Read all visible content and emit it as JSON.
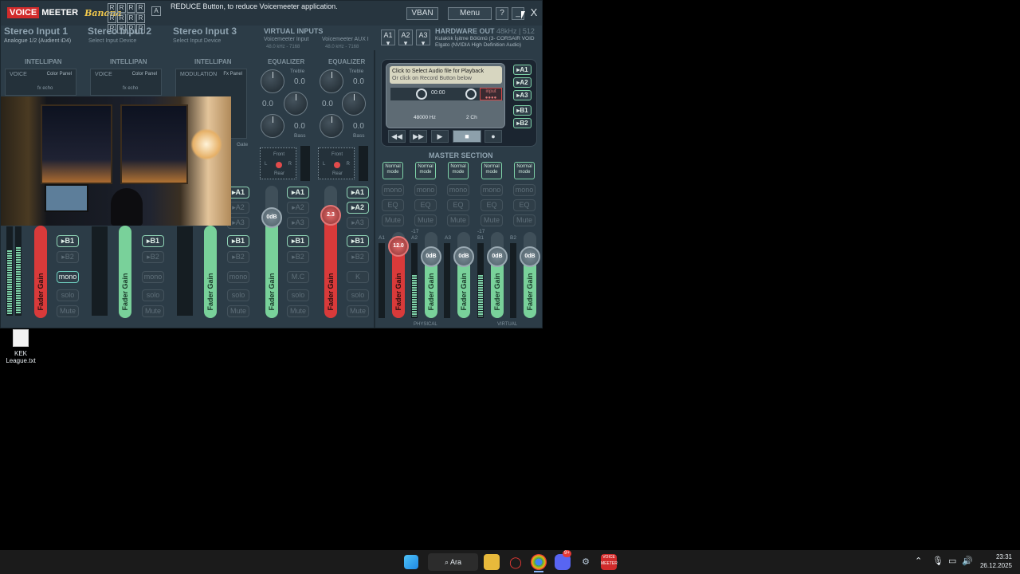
{
  "app": {
    "logo_voice": "VOICE",
    "logo_meeter": "MEETER",
    "logo_banana": "Banana",
    "r_letters": [
      "R",
      "R",
      "R",
      "R",
      "R",
      "R",
      "R",
      "R",
      "R",
      "R",
      "R",
      "R"
    ],
    "a_letter": "A",
    "tooltip": "REDUCE Button, to reduce Voicemeeter application.",
    "vban_label": "VBAN",
    "menu_label": "Menu",
    "help_label": "?",
    "minimize_label": "_",
    "close_label": "X"
  },
  "strips": [
    {
      "title": "Stereo Input 1",
      "device": "Analogue 1/2 (Audient iD4)",
      "intellipan": "INTELLIPAN",
      "panel_left": "VOICE",
      "panel_right": "Color Panel",
      "panel_sub": "fx echo"
    },
    {
      "title": "Stereo Input 2",
      "device": "Select Input Device",
      "intellipan": "INTELLIPAN",
      "panel_left": "VOICE",
      "panel_right": "Color Panel",
      "panel_sub": "fx echo"
    },
    {
      "title": "Stereo Input 3",
      "device": "Select Input Device",
      "intellipan": "INTELLIPAN",
      "panel_left": "MODULATION",
      "panel_right": "Fx Panel",
      "panel_sub": ""
    }
  ],
  "virtual_inputs": {
    "title": "VIRTUAL INPUTS",
    "vi1_name": "Voicemeeter Input",
    "vi1_rate": "48.0 kHz - 7168",
    "vi2_name": "Voicemeeter AUX I",
    "vi2_rate": "48.0 kHz - 7168",
    "eq_label": "EQUALIZER",
    "treble": "Treble",
    "bass": "Bass",
    "eq_vals": [
      "0.0",
      "0.0",
      "0.0",
      "0.0",
      "0.0",
      "0.0"
    ],
    "pan_front": "Front",
    "pan_rear": "Rear",
    "pan_l": "L",
    "pan_r": "R",
    "gate": "Gate"
  },
  "a_buttons": [
    "A1",
    "A2",
    "A3"
  ],
  "hardware_out": {
    "title": "HARDWARE OUT",
    "rate": "48kHz | 512",
    "dev1": "Kulaklık İşitme Bölümü (3- CORSAIR VOID",
    "dev2": "Elgato (NVIDIA High Definition Audio)"
  },
  "buses": {
    "a1": "A1",
    "a2": "A2",
    "a3": "A3",
    "b1": "B1",
    "b2": "B2",
    "mono": "mono",
    "solo": "solo",
    "mute": "Mute",
    "mc": "M.C",
    "k": "K",
    "fader_gain": "Fader Gain"
  },
  "faders": {
    "vi1_value": "0dB",
    "vi2_value": "2.3",
    "master_a1_value": "12.0",
    "master_other_value": "0dB"
  },
  "recorder": {
    "line1": "Click to Select Audio file for Playback",
    "line2": "Or click on Record Button below",
    "time": "00:00",
    "input": "input",
    "hz": "48000 Hz",
    "ch": "2 Ch",
    "outs": [
      "A1",
      "A2",
      "A3",
      "B1",
      "B2"
    ],
    "transport": [
      "◀◀",
      "▶▶",
      "▶",
      "■",
      "●"
    ]
  },
  "master": {
    "title": "MASTER SECTION",
    "normal_mode": "Normal mode",
    "mono": "mono",
    "eq": "EQ",
    "mute": "Mute",
    "bus_labels": [
      "A1",
      "A2",
      "A3",
      "B1",
      "B2"
    ],
    "levels": [
      "-17",
      "-17"
    ],
    "physical": "PHYSICAL",
    "virtual": "VIRTUAL"
  },
  "desktop": {
    "file_label": "KEK League.txt"
  },
  "taskbar": {
    "search_label": "Ara",
    "time": "23:31",
    "date": "26.12.2025",
    "discord_badge": "9+"
  },
  "colors": {
    "red_fader": "#d93a3a",
    "green_fader": "#79d19a",
    "background": "#2c3c47"
  }
}
